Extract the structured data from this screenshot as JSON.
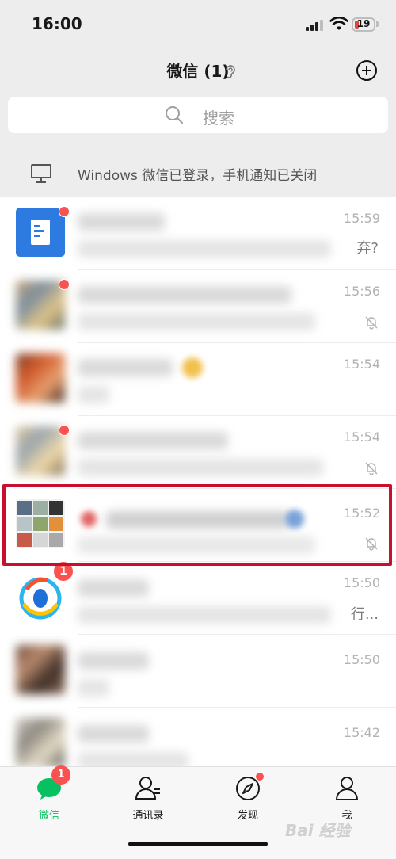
{
  "status": {
    "time": "16:00",
    "battery": "19"
  },
  "nav": {
    "title": "微信 (1)"
  },
  "search": {
    "placeholder": "搜索"
  },
  "banner": {
    "text": "Windows 微信已登录，手机通知已关闭"
  },
  "chats": [
    {
      "time": "15:59",
      "preview_tail": "弃?",
      "unread_dot": true,
      "muted": false
    },
    {
      "time": "15:56",
      "unread_dot": true,
      "muted": true
    },
    {
      "time": "15:54",
      "unread_dot": false,
      "muted": false
    },
    {
      "time": "15:54",
      "unread_dot": true,
      "muted": true
    },
    {
      "time": "15:52",
      "unread_dot": false,
      "muted": true,
      "highlighted": true
    },
    {
      "time": "15:50",
      "preview_tail": "行...",
      "unread_badge": "1",
      "muted": false
    },
    {
      "time": "15:50",
      "unread_dot": false,
      "muted": false
    },
    {
      "time": "15:42",
      "unread_dot": false,
      "muted": false
    }
  ],
  "tabs": [
    {
      "label": "微信",
      "icon": "chat-icon",
      "badge": "1",
      "active": true
    },
    {
      "label": "通讯录",
      "icon": "contacts-icon"
    },
    {
      "label": "发现",
      "icon": "compass-icon",
      "dot": true
    },
    {
      "label": "我",
      "icon": "person-icon"
    }
  ],
  "watermark": "Bai 经验",
  "colors": {
    "accent": "#07c160",
    "badge": "#fa5151",
    "highlight": "#c8102e"
  }
}
